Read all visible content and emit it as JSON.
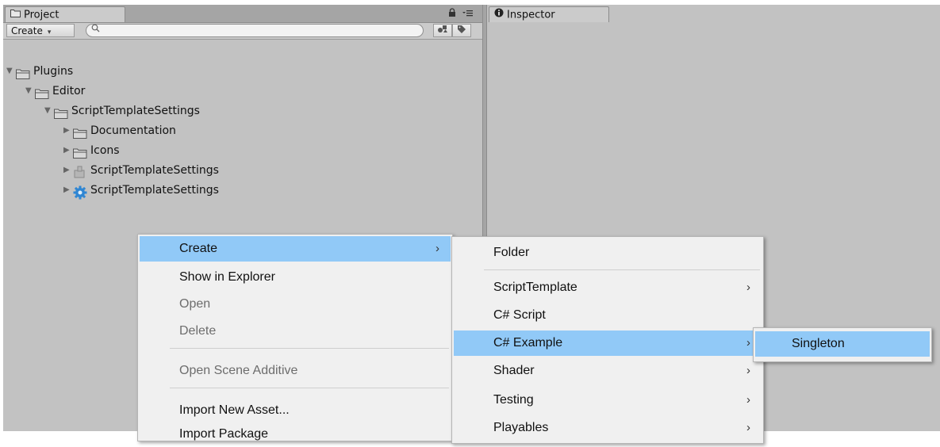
{
  "project_panel": {
    "tab_label": "Project",
    "toolbar": {
      "create_label": "Create",
      "create_arrow": "▾",
      "search_placeholder": ""
    },
    "tree": [
      {
        "label": "Plugins",
        "indent": 0,
        "expanded": true,
        "icon": "folder-icon"
      },
      {
        "label": "Editor",
        "indent": 1,
        "expanded": true,
        "icon": "folder-icon"
      },
      {
        "label": "ScriptTemplateSettings",
        "indent": 2,
        "expanded": true,
        "icon": "folder-icon"
      },
      {
        "label": "Documentation",
        "indent": 3,
        "expanded": false,
        "icon": "folder-icon"
      },
      {
        "label": "Icons",
        "indent": 3,
        "expanded": false,
        "icon": "folder-icon"
      },
      {
        "label": "ScriptTemplateSettings",
        "indent": 3,
        "expanded": false,
        "icon": "assembly-icon"
      },
      {
        "label": "ScriptTemplateSettings",
        "indent": 3,
        "expanded": false,
        "icon": "settings-gear-icon"
      }
    ]
  },
  "inspector_panel": {
    "tab_label": "Inspector"
  },
  "context_menu": {
    "items": [
      {
        "label": "Create",
        "highlighted": true,
        "disabled": false,
        "submenu": true
      },
      {
        "label": "Show in Explorer",
        "highlighted": false,
        "disabled": false,
        "submenu": false
      },
      {
        "label": "Open",
        "highlighted": false,
        "disabled": true,
        "submenu": false
      },
      {
        "label": "Delete",
        "highlighted": false,
        "disabled": true,
        "submenu": false
      },
      {
        "label": "Open Scene Additive",
        "highlighted": false,
        "disabled": true,
        "submenu": false
      },
      {
        "label": "Import New Asset...",
        "highlighted": false,
        "disabled": false,
        "submenu": false
      },
      {
        "label": "Import Package",
        "highlighted": false,
        "disabled": false,
        "submenu": false
      }
    ]
  },
  "create_submenu": {
    "items": [
      {
        "label": "Folder",
        "highlighted": false,
        "submenu": false
      },
      {
        "label": "ScriptTemplate",
        "highlighted": false,
        "submenu": true
      },
      {
        "label": "C# Script",
        "highlighted": false,
        "submenu": false
      },
      {
        "label": "C# Example",
        "highlighted": true,
        "submenu": true
      },
      {
        "label": "Shader",
        "highlighted": false,
        "submenu": true
      },
      {
        "label": "Testing",
        "highlighted": false,
        "submenu": true
      },
      {
        "label": "Playables",
        "highlighted": false,
        "submenu": true
      }
    ]
  },
  "example_submenu": {
    "items": [
      {
        "label": "Singleton",
        "highlighted": true
      }
    ]
  },
  "colors": {
    "panel_bg": "#c2c2c2",
    "highlight": "#91c9f7",
    "menu_bg": "#f0f0f0",
    "disabled_text": "#6d6d6d"
  },
  "submenu_arrow": "›"
}
